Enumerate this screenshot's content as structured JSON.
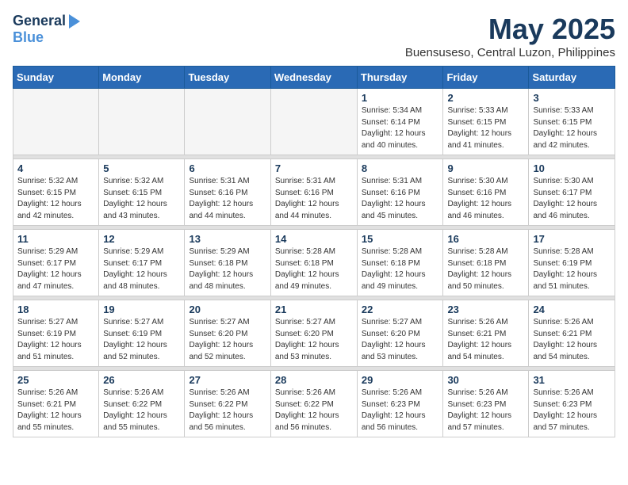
{
  "header": {
    "logo_general": "General",
    "logo_blue": "Blue",
    "month": "May 2025",
    "location": "Buensuseso, Central Luzon, Philippines"
  },
  "weekdays": [
    "Sunday",
    "Monday",
    "Tuesday",
    "Wednesday",
    "Thursday",
    "Friday",
    "Saturday"
  ],
  "weeks": [
    [
      {
        "day": "",
        "info": ""
      },
      {
        "day": "",
        "info": ""
      },
      {
        "day": "",
        "info": ""
      },
      {
        "day": "",
        "info": ""
      },
      {
        "day": "1",
        "info": "Sunrise: 5:34 AM\nSunset: 6:14 PM\nDaylight: 12 hours\nand 40 minutes."
      },
      {
        "day": "2",
        "info": "Sunrise: 5:33 AM\nSunset: 6:15 PM\nDaylight: 12 hours\nand 41 minutes."
      },
      {
        "day": "3",
        "info": "Sunrise: 5:33 AM\nSunset: 6:15 PM\nDaylight: 12 hours\nand 42 minutes."
      }
    ],
    [
      {
        "day": "4",
        "info": "Sunrise: 5:32 AM\nSunset: 6:15 PM\nDaylight: 12 hours\nand 42 minutes."
      },
      {
        "day": "5",
        "info": "Sunrise: 5:32 AM\nSunset: 6:15 PM\nDaylight: 12 hours\nand 43 minutes."
      },
      {
        "day": "6",
        "info": "Sunrise: 5:31 AM\nSunset: 6:16 PM\nDaylight: 12 hours\nand 44 minutes."
      },
      {
        "day": "7",
        "info": "Sunrise: 5:31 AM\nSunset: 6:16 PM\nDaylight: 12 hours\nand 44 minutes."
      },
      {
        "day": "8",
        "info": "Sunrise: 5:31 AM\nSunset: 6:16 PM\nDaylight: 12 hours\nand 45 minutes."
      },
      {
        "day": "9",
        "info": "Sunrise: 5:30 AM\nSunset: 6:16 PM\nDaylight: 12 hours\nand 46 minutes."
      },
      {
        "day": "10",
        "info": "Sunrise: 5:30 AM\nSunset: 6:17 PM\nDaylight: 12 hours\nand 46 minutes."
      }
    ],
    [
      {
        "day": "11",
        "info": "Sunrise: 5:29 AM\nSunset: 6:17 PM\nDaylight: 12 hours\nand 47 minutes."
      },
      {
        "day": "12",
        "info": "Sunrise: 5:29 AM\nSunset: 6:17 PM\nDaylight: 12 hours\nand 48 minutes."
      },
      {
        "day": "13",
        "info": "Sunrise: 5:29 AM\nSunset: 6:18 PM\nDaylight: 12 hours\nand 48 minutes."
      },
      {
        "day": "14",
        "info": "Sunrise: 5:28 AM\nSunset: 6:18 PM\nDaylight: 12 hours\nand 49 minutes."
      },
      {
        "day": "15",
        "info": "Sunrise: 5:28 AM\nSunset: 6:18 PM\nDaylight: 12 hours\nand 49 minutes."
      },
      {
        "day": "16",
        "info": "Sunrise: 5:28 AM\nSunset: 6:18 PM\nDaylight: 12 hours\nand 50 minutes."
      },
      {
        "day": "17",
        "info": "Sunrise: 5:28 AM\nSunset: 6:19 PM\nDaylight: 12 hours\nand 51 minutes."
      }
    ],
    [
      {
        "day": "18",
        "info": "Sunrise: 5:27 AM\nSunset: 6:19 PM\nDaylight: 12 hours\nand 51 minutes."
      },
      {
        "day": "19",
        "info": "Sunrise: 5:27 AM\nSunset: 6:19 PM\nDaylight: 12 hours\nand 52 minutes."
      },
      {
        "day": "20",
        "info": "Sunrise: 5:27 AM\nSunset: 6:20 PM\nDaylight: 12 hours\nand 52 minutes."
      },
      {
        "day": "21",
        "info": "Sunrise: 5:27 AM\nSunset: 6:20 PM\nDaylight: 12 hours\nand 53 minutes."
      },
      {
        "day": "22",
        "info": "Sunrise: 5:27 AM\nSunset: 6:20 PM\nDaylight: 12 hours\nand 53 minutes."
      },
      {
        "day": "23",
        "info": "Sunrise: 5:26 AM\nSunset: 6:21 PM\nDaylight: 12 hours\nand 54 minutes."
      },
      {
        "day": "24",
        "info": "Sunrise: 5:26 AM\nSunset: 6:21 PM\nDaylight: 12 hours\nand 54 minutes."
      }
    ],
    [
      {
        "day": "25",
        "info": "Sunrise: 5:26 AM\nSunset: 6:21 PM\nDaylight: 12 hours\nand 55 minutes."
      },
      {
        "day": "26",
        "info": "Sunrise: 5:26 AM\nSunset: 6:22 PM\nDaylight: 12 hours\nand 55 minutes."
      },
      {
        "day": "27",
        "info": "Sunrise: 5:26 AM\nSunset: 6:22 PM\nDaylight: 12 hours\nand 56 minutes."
      },
      {
        "day": "28",
        "info": "Sunrise: 5:26 AM\nSunset: 6:22 PM\nDaylight: 12 hours\nand 56 minutes."
      },
      {
        "day": "29",
        "info": "Sunrise: 5:26 AM\nSunset: 6:23 PM\nDaylight: 12 hours\nand 56 minutes."
      },
      {
        "day": "30",
        "info": "Sunrise: 5:26 AM\nSunset: 6:23 PM\nDaylight: 12 hours\nand 57 minutes."
      },
      {
        "day": "31",
        "info": "Sunrise: 5:26 AM\nSunset: 6:23 PM\nDaylight: 12 hours\nand 57 minutes."
      }
    ]
  ]
}
